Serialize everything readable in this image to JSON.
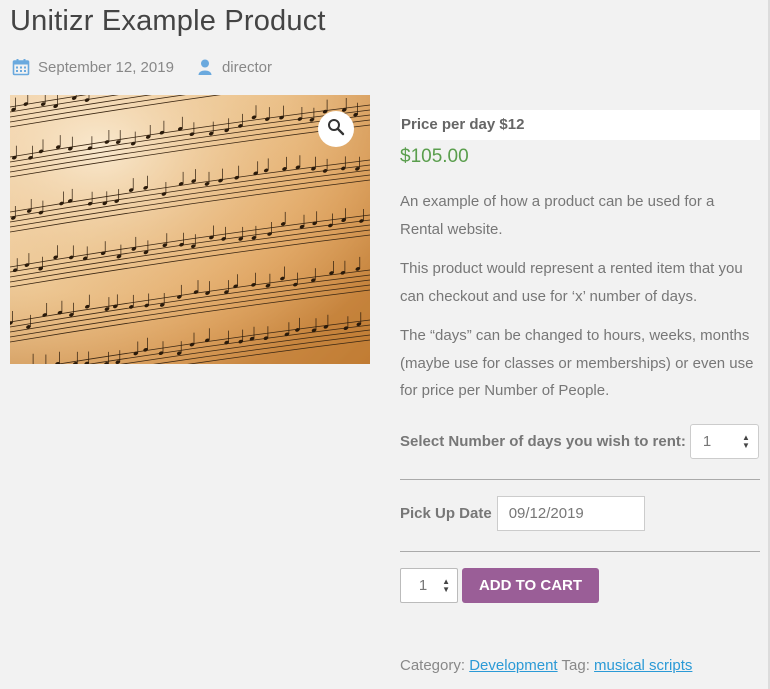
{
  "product": {
    "title": "Unitizr Example Product",
    "date": "September 12, 2019",
    "author": "director",
    "price_per_day": "Price per day $12",
    "price": "$105.00",
    "description": [
      "An example of how a product can be used for a Rental website.",
      "This product would represent a rented item that you can checkout and use for ‘x’ number of days.",
      "The “days” can be changed to hours, weeks, months (maybe use for classes or memberships) or even use for price per Number of People."
    ]
  },
  "rent": {
    "label": "Select Number of days you wish to rent:",
    "value": "1"
  },
  "pickup": {
    "label": "Pick Up Date",
    "value": "09/12/2019"
  },
  "cart": {
    "quantity": "1",
    "button": "ADD TO CART"
  },
  "meta": {
    "category_label": "Category:",
    "category": "Development",
    "tag_label": "Tag:",
    "tag": "musical scripts"
  },
  "colors": {
    "price": "#5a9e4d",
    "button": "#9a5e97",
    "link": "#2b9ad6",
    "meta_icon": "#6aa9de"
  },
  "icons": [
    "calendar-icon",
    "user-icon",
    "zoom-magnifier-icon"
  ]
}
